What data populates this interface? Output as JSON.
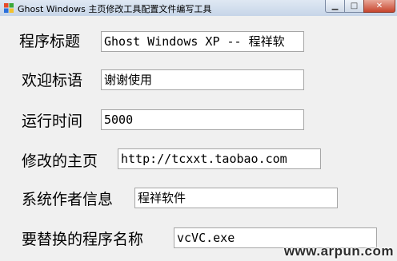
{
  "window": {
    "title": "Ghost Windows 主页修改工具配置文件编写工具",
    "controls": [
      "minimize-icon",
      "maximize-icon",
      "close-icon"
    ]
  },
  "fields": [
    {
      "label": "程序标题",
      "value": "Ghost Windows XP  -- 程祥软"
    },
    {
      "label": "欢迎标语",
      "value": "谢谢使用"
    },
    {
      "label": "运行时间",
      "value": "5000"
    },
    {
      "label": "修改的主页",
      "value": "http://tcxxt.taobao.com"
    },
    {
      "label": "系统作者信息",
      "value": "程祥软件"
    },
    {
      "label": "要替换的程序名称",
      "value": "vcVC.exe"
    }
  ],
  "watermark": "www.arpun.com"
}
